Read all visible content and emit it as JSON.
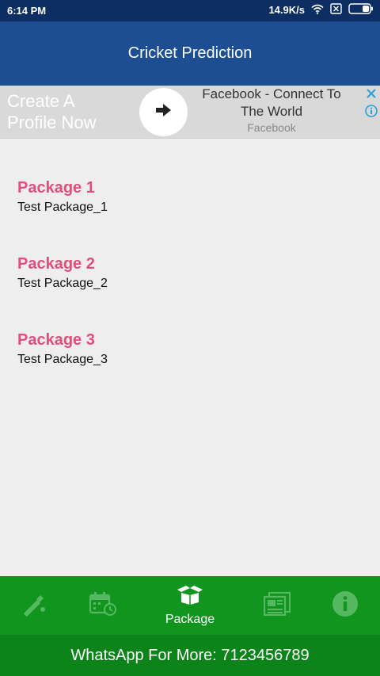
{
  "status_bar": {
    "time": "6:14 PM",
    "speed": "14.9K/s"
  },
  "app_bar": {
    "title": "Cricket Prediction"
  },
  "ad": {
    "left_text": "Create A Profile Now",
    "title": "Facebook - Connect To The World",
    "advertiser": "Facebook"
  },
  "packages": [
    {
      "title": "Package 1",
      "description": "Test Package_1"
    },
    {
      "title": "Package 2",
      "description": "Test Package_2"
    },
    {
      "title": "Package 3",
      "description": "Test Package_3"
    }
  ],
  "bottom_nav": {
    "items": [
      {
        "icon": "cricket-bat-icon",
        "label": ""
      },
      {
        "icon": "calendar-clock-icon",
        "label": ""
      },
      {
        "icon": "package-icon",
        "label": "Package",
        "active": true
      },
      {
        "icon": "news-icon",
        "label": ""
      },
      {
        "icon": "info-icon",
        "label": ""
      }
    ]
  },
  "footer": {
    "whatsapp_text": "WhatsApp For More: 7123456789"
  },
  "colors": {
    "status_bar": "#0d2e62",
    "app_bar": "#1d4e91",
    "package_title": "#e24e7c",
    "nav_background": "#11951f",
    "footer_background": "#0c8419"
  }
}
